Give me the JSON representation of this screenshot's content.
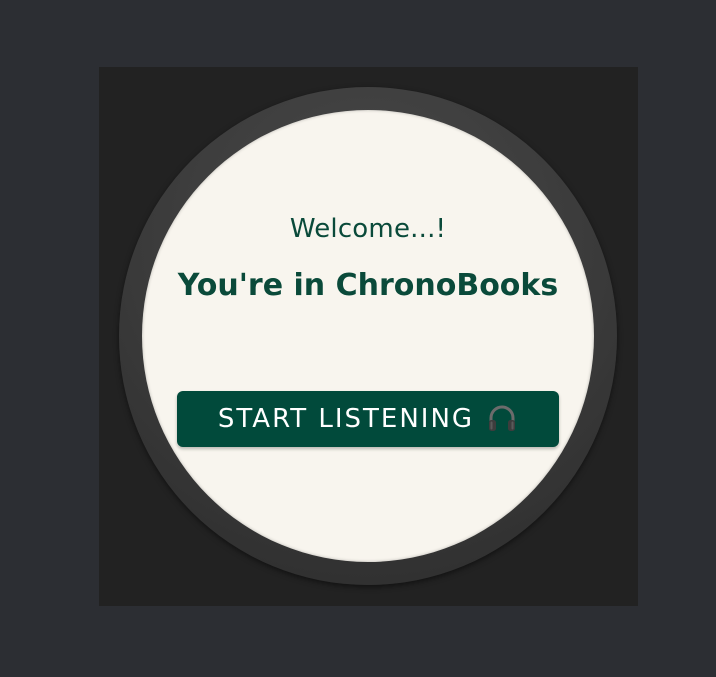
{
  "screen": {
    "welcome_text": "Welcome...!",
    "brand_text": "You're in ChronoBooks"
  },
  "start_button": {
    "label": "START LISTENING",
    "icon": "headphones-icon"
  },
  "colors": {
    "background": "#2c2e33",
    "watch_face": "#f8f5ee",
    "accent": "#014a3b",
    "text_primary": "#0a4a3a"
  }
}
